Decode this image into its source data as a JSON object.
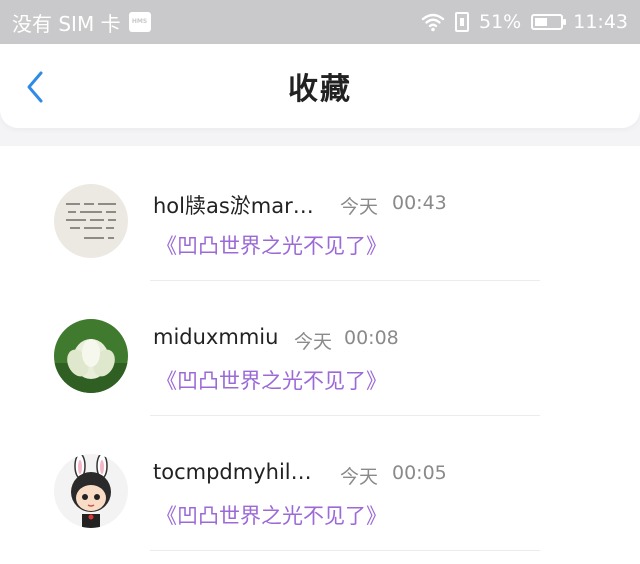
{
  "status_bar": {
    "carrier": "没有 SIM 卡",
    "hms_badge": "HMS",
    "battery_percent_text": "51%",
    "battery_level": 0.51,
    "time": "11:43"
  },
  "header": {
    "title": "收藏",
    "back_icon": "chevron-left-icon"
  },
  "favorites": [
    {
      "name": "hol牍as淤mar…",
      "date": "今天",
      "time": "00:43",
      "message": "《凹凸世界之光不见了》",
      "avatar": "calligraphy"
    },
    {
      "name": "miduxmmiu",
      "date": "今天",
      "time": "00:08",
      "message": "《凹凸世界之光不见了》",
      "avatar": "lotus"
    },
    {
      "name": "tocmpdmyhil…",
      "date": "今天",
      "time": "00:05",
      "message": "《凹凸世界之光不见了》",
      "avatar": "bunny-character"
    }
  ],
  "colors": {
    "accent": "#2f8be6",
    "message": "#9b6ad6",
    "status_bar": "#c9c9cb"
  }
}
